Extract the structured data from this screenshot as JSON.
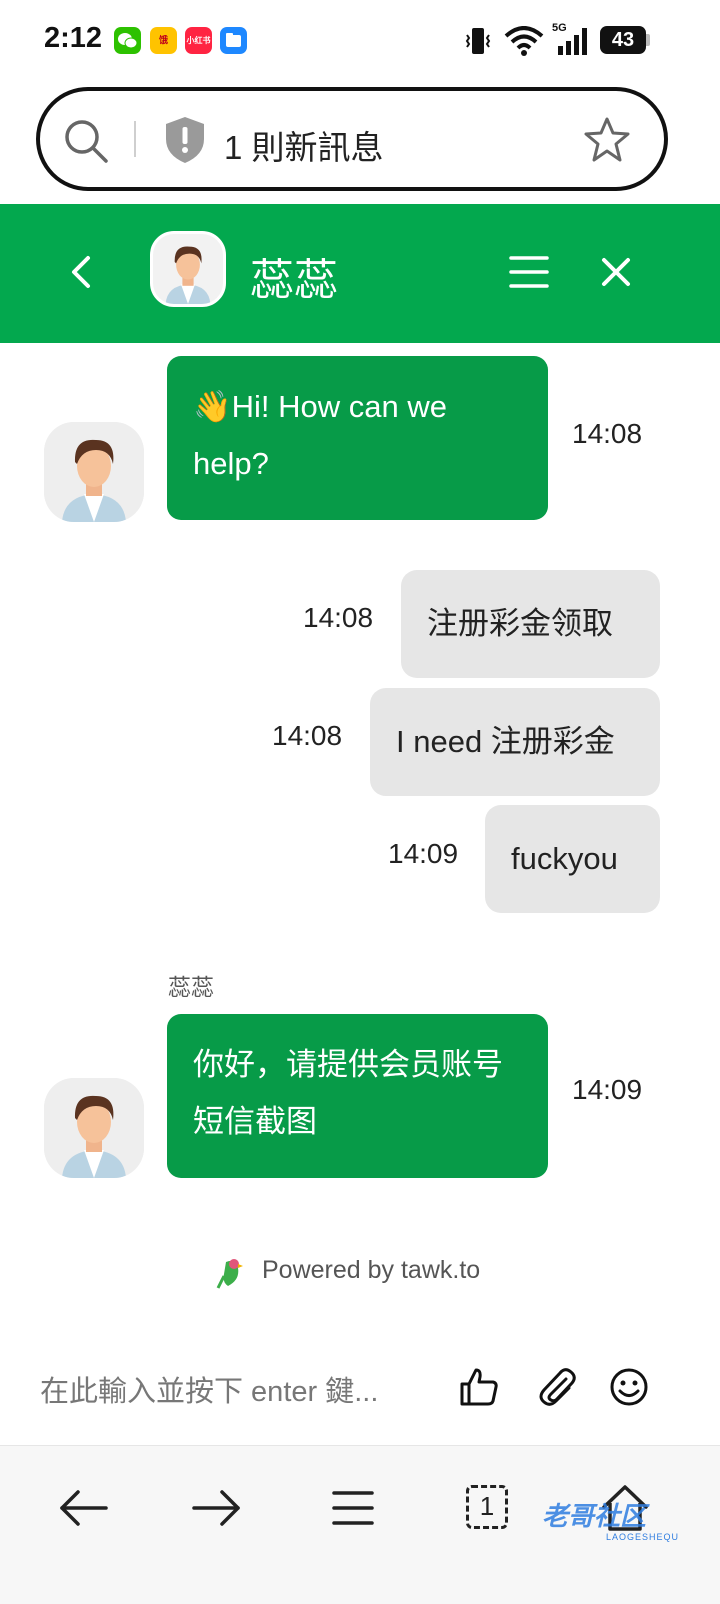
{
  "status_bar": {
    "time": "2:12",
    "battery": "43",
    "network": "5G",
    "app_icons": [
      {
        "name": "wechat-icon",
        "color": "#2dc100",
        "label": ""
      },
      {
        "name": "meituan-icon",
        "color": "#ffc300",
        "label": "饿"
      },
      {
        "name": "xiaohongshu-icon",
        "color": "#ff2442",
        "label": "小红书"
      },
      {
        "name": "files-icon",
        "color": "#1e88ff",
        "label": ""
      }
    ]
  },
  "browser": {
    "title": "1 則新訊息"
  },
  "chat": {
    "agent_name": "蕊蕊",
    "accent_color": "#03a84e",
    "messages": [
      {
        "from": "agent",
        "text": "Hi! How can we help?",
        "emoji": "👋",
        "time": "14:08"
      },
      {
        "from": "user",
        "text": "注册彩金领取",
        "time": "14:08"
      },
      {
        "from": "user",
        "text": "I need 注册彩金",
        "time": "14:08"
      },
      {
        "from": "user",
        "text": "fuckyou",
        "time": "14:09"
      },
      {
        "from": "agent",
        "sender": "蕊蕊",
        "text": "你好，请提供会员账号短信截图",
        "time": "14:09"
      }
    ],
    "powered_by": "Powered by tawk.to",
    "input_placeholder": "在此輸入並按下 enter 鍵..."
  },
  "bottom_nav": {
    "tab_count": "1",
    "watermark": "老哥社区",
    "watermark_sub": "LAOGESHEQU"
  }
}
